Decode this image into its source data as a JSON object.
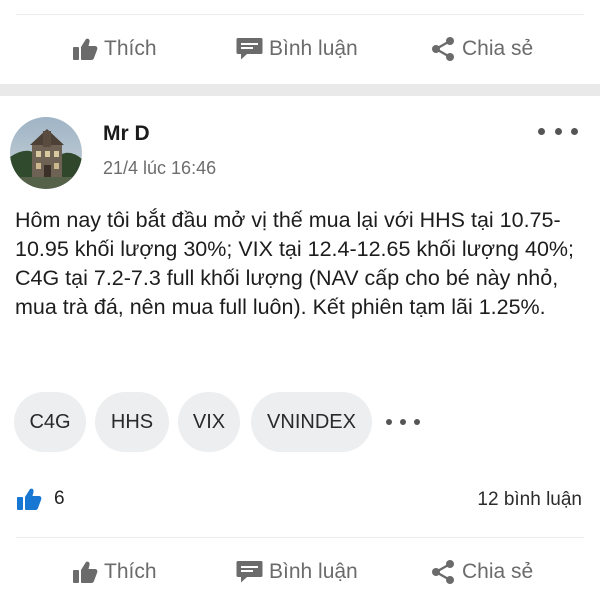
{
  "top_actions": {
    "like_label": "Thích",
    "comment_label": "Bình luận",
    "share_label": "Chia sẻ"
  },
  "post": {
    "author": "Mr D",
    "timestamp": "21/4 lúc 16:46",
    "text": "Hôm nay tôi bắt đầu mở vị thế mua lại với HHS tại 10.75-10.95 khối lượng 30%; VIX tại 12.4-12.65 khối lượng 40%; C4G tại 7.2-7.3 full khối lượng (NAV cấp cho bé này nhỏ, mua trà đá, nên mua full luôn). Kết phiên tạm lãi 1.25%.",
    "tags": [
      "C4G",
      "HHS",
      "VIX",
      "VNINDEX"
    ],
    "like_count": "6",
    "comment_count": "12 bình luận"
  },
  "bottom_actions": {
    "like_label": "Thích",
    "comment_label": "Bình luận",
    "share_label": "Chia sẻ"
  },
  "colors": {
    "accent_like": "#1877d2",
    "action_gray": "#6b6b6b",
    "separator": "#e9e9e9",
    "tag_bg": "#eceeef"
  },
  "icons": {
    "like": "thumbs-up-icon",
    "comment": "comment-icon",
    "share": "share-icon",
    "more": "more-icon"
  }
}
